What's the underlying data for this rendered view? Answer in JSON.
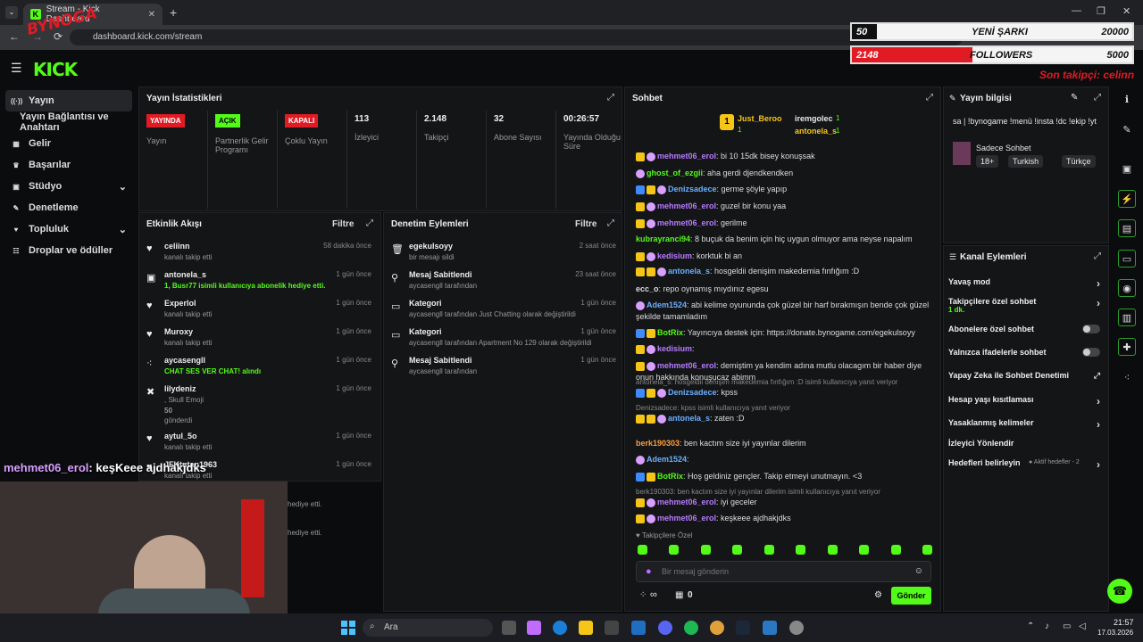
{
  "browser": {
    "tab_title": "Stream - Kick Dashboard",
    "url": "dashboard.kick.com/stream",
    "new_tab": "+"
  },
  "overlay": {
    "brand": "BYNOGA",
    "songs_count": "50",
    "songs_label": "YENİ ŞARKI",
    "songs_goal": "20000",
    "songs_progress": 0.0025,
    "followers_count": "2148",
    "followers_label": "FOLLOWERS",
    "followers_goal": "5000",
    "followers_progress": 0.43,
    "last_follower": "Son takipçi: celinn",
    "chat_overlay_user": "mehmet06_erol",
    "chat_overlay_msg": ": keşKeee ajdhakjdks"
  },
  "logo": "KICK",
  "sidebar": [
    {
      "label": "Yayın",
      "icon": "broadcast-icon",
      "active": true
    },
    {
      "label": "Yayın Bağlantısı ve Anahtarı",
      "icon": "",
      "active": false
    },
    {
      "label": "Gelir",
      "icon": "revenue-icon"
    },
    {
      "label": "Başarılar",
      "icon": "trophy-icon"
    },
    {
      "label": "Stüdyo",
      "icon": "studio-icon",
      "chevron": "⌄"
    },
    {
      "label": "Denetleme",
      "icon": "wrench-icon"
    },
    {
      "label": "Topluluk",
      "icon": "community-icon",
      "chevron": "⌄"
    },
    {
      "label": "Droplar ve ödüller",
      "icon": "gift-icon"
    }
  ],
  "stats": {
    "title": "Yayın İstatistikleri",
    "items": [
      {
        "badge": "YAYINDA",
        "label": "Yayın",
        "badge_color": "#e01b24",
        "badge_text": "#fff"
      },
      {
        "badge": "AÇIK",
        "label": "Partnerlik Gelir Programı",
        "badge_color": "#53fc18",
        "badge_text": "#000"
      },
      {
        "badge": "KAPALI",
        "label": "Çoklu Yayın",
        "badge_color": "#e01b24",
        "badge_text": "#fff"
      },
      {
        "value": "113",
        "label": "İzleyici"
      },
      {
        "value": "2.148",
        "label": "Takipçi"
      },
      {
        "value": "32",
        "label": "Abone Sayısı"
      },
      {
        "value": "00:26:57",
        "label": "Yayında Olduğu Süre"
      }
    ]
  },
  "activity": {
    "title": "Etkinlik Akışı",
    "filter": "Filtre",
    "items": [
      {
        "name": "celiinn",
        "sub": "kanalı takip etti",
        "time": "58 dakika önce",
        "icon": "heart-icon"
      },
      {
        "name": "antonela_s",
        "sub": "1, Busr77 isimli kullanıcıya abonelik hediye etti.",
        "time": "1 gün önce",
        "icon": "gift-icon"
      },
      {
        "name": "Experlol",
        "sub": "kanalı takip etti",
        "time": "1 gün önce",
        "icon": "heart-icon"
      },
      {
        "name": "Muroxy",
        "sub": "kanalı takip etti",
        "time": "1 gün önce",
        "icon": "heart-icon"
      },
      {
        "name": "aycasengll",
        "sub": "CHAT SES VER CHAT! alındı",
        "time": "1 gün önce",
        "icon": "reward-icon"
      },
      {
        "name": "lilydeniz",
        "sub": ", Skull Emoji",
        "sub2": "50",
        "sub3": "gönderdi",
        "time": "1 gün önce",
        "icon": "kicks-icon"
      },
      {
        "name": "aytul_5o",
        "sub": "kanalı takip etti",
        "time": "1 gün önce",
        "icon": "heart-icon"
      },
      {
        "name": "JFKtutan1963",
        "sub": "kanalı takip etti",
        "time": "1 gün önce",
        "icon": "heart-icon"
      }
    ],
    "extra": [
      "hediye etti.",
      "hediye etti."
    ]
  },
  "mod": {
    "title": "Denetim Eylemleri",
    "filter": "Filtre",
    "items": [
      {
        "name": "egekulsoyy",
        "sub": "bir mesajı sildi",
        "time": "2 saat önce",
        "icon": "trash-icon"
      },
      {
        "name": "Mesaj Sabitlendi",
        "sub": "aycasengll tarafından",
        "time": "23 saat önce",
        "icon": "pin-icon"
      },
      {
        "name": "Kategori",
        "sub": "aycasengll tarafından Just Chatting olarak değiştirildi",
        "time": "1 gün önce",
        "icon": "category-icon"
      },
      {
        "name": "Kategori",
        "sub": "aycasengll tarafından Apartment No 129 olarak değiştirildi",
        "time": "1 gün önce",
        "icon": "category-icon"
      },
      {
        "name": "Mesaj Sabitlendi",
        "sub": "aycasengll tarafından",
        "time": "1 gün önce",
        "icon": "pin-icon"
      }
    ]
  },
  "chat": {
    "title": "Sohbet",
    "top": [
      {
        "rank": "1",
        "name": "Just_Beroo",
        "count": "1"
      },
      {
        "name": "iremgolec",
        "count": "1"
      },
      {
        "name": "antonela_s",
        "count": "1"
      }
    ],
    "messages": [
      {
        "user": "mehmet06_erol",
        "color": "#b77bff",
        "badges": [
          "crown",
          "flame"
        ],
        "text": ": bi 10 15dk bisey konuşsak"
      },
      {
        "user": "ghost_of_ezgii",
        "color": "#53fc18",
        "badges": [
          "flame"
        ],
        "text": ": aha gerdi djendkendken"
      },
      {
        "user": "Denizsadece",
        "color": "#6ab0ff",
        "badges": [
          "blue",
          "crown",
          "flame"
        ],
        "text": ": germe şöyle yapıp"
      },
      {
        "user": "mehmet06_erol",
        "color": "#b77bff",
        "badges": [
          "crown",
          "flame"
        ],
        "text": ": guzel bir konu yaa"
      },
      {
        "user": "mehmet06_erol",
        "color": "#b77bff",
        "badges": [
          "crown",
          "flame"
        ],
        "text": ": gerilme"
      },
      {
        "user": "kubrayranci94",
        "color": "#53fc18",
        "badges": [],
        "text": ": 8 buçuk da benim için hiç uygun olmuyor ama neyse napalım"
      },
      {
        "user": "kedisium",
        "color": "#b77bff",
        "badges": [
          "crown",
          "flame"
        ],
        "text": ": korktuk bi an"
      },
      {
        "user": "antonela_s",
        "color": "#6ab0ff",
        "badges": [
          "crown",
          "crown",
          "flame"
        ],
        "text": ": hosgeldii denişim makedemia fınfığım :D"
      },
      {
        "user": "ecc_o",
        "color": "#ddd",
        "badges": [],
        "text": ": repo oynamış mıydınız egesu"
      },
      {
        "user": "Adem1524",
        "color": "#6ab0ff",
        "badges": [
          "flame"
        ],
        "text": ": abi kelime oyununda çok güzel bir harf bırakmışın bende çok güzel şekilde tamamladım"
      },
      {
        "user": "BotRix",
        "color": "#53fc18",
        "badges": [
          "blue",
          "crown"
        ],
        "text": ": Yayıncıya destek için: https://donate.bynogame.com/egekulsoyy"
      },
      {
        "user": "kedisium",
        "color": "#b77bff",
        "badges": [
          "crown",
          "flame"
        ],
        "text": ":"
      },
      {
        "user": "mehmet06_erol",
        "color": "#b77bff",
        "badges": [
          "crown",
          "flame"
        ],
        "text": ": demiştim ya kendim adına mutlu olacagım bir haber diye onun hakkında konuşucaz abimm"
      },
      {
        "reply": "antonela_s: hosgeldii denişim makedemia fınfığım :D isimli kullanıcıya yanıt veriyor",
        "user": "Denizsadece",
        "color": "#6ab0ff",
        "badges": [
          "blue",
          "crown",
          "flame"
        ],
        "text": ": kpss"
      },
      {
        "reply": "Denizsadece: kpss isimli kullanıcıya yanıt veriyor",
        "user": "antonela_s",
        "color": "#6ab0ff",
        "badges": [
          "crown",
          "crown",
          "flame"
        ],
        "text": ": zaten :D"
      },
      {
        "user": "berk190303",
        "color": "#ff9d3d",
        "badges": [],
        "text": ": ben kactım size iyi yayınlar dilerim"
      },
      {
        "user": "Adem1524",
        "color": "#6ab0ff",
        "badges": [
          "flame"
        ],
        "text": ":"
      },
      {
        "user": "BotRix",
        "color": "#53fc18",
        "badges": [
          "blue",
          "crown"
        ],
        "text": ": Hoş geldiniz gençler. Takip etmeyi unutmayın. <3"
      },
      {
        "reply": "berk190303: ben kactım size iyi yayınlar dilerim isimli kullanıcıya yanıt veriyor",
        "user": "mehmet06_erol",
        "color": "#b77bff",
        "badges": [
          "crown",
          "flame"
        ],
        "text": ": iyi geceler"
      },
      {
        "user": "mehmet06_erol",
        "color": "#b77bff",
        "badges": [
          "crown",
          "flame"
        ],
        "text": ": keşkeee ajdhakjdks"
      }
    ],
    "followers_only": "Takipçilere Özel",
    "placeholder": "Bir mesaj gönderin",
    "points": "∞",
    "kicks": "0",
    "send": "Gönder"
  },
  "streaminfo": {
    "title": "Yayın bilgisi",
    "stream_title": "sa | !bynogame !menü !insta !dc !ekip !yt",
    "category": "Sadece Sohbet",
    "tags": [
      "18+",
      "Turkish",
      "Türkçe"
    ]
  },
  "channel": {
    "title": "Kanal Eylemleri",
    "rows": [
      {
        "label": "Yavaş mod",
        "control": "chevron"
      },
      {
        "label": "Takipçilere özel sohbet",
        "sub": "1 dk.",
        "control": "chevron"
      },
      {
        "label": "Abonelere özel sohbet",
        "control": "toggle"
      },
      {
        "label": "Yalnızca ifadelerle sohbet",
        "control": "toggle"
      },
      {
        "label": "Yapay Zeka ile Sohbet Denetimi",
        "control": "external"
      },
      {
        "label": "Hesap yaşı kısıtlaması",
        "control": "chevron"
      },
      {
        "label": "Yasaklanmış kelimeler",
        "control": "chevron"
      },
      {
        "label": "İzleyici Yönlendir",
        "control": "none"
      },
      {
        "label": "Hedefleri belirleyin",
        "sub": "● Aktif hedefler - 2",
        "control": "chevron"
      }
    ]
  },
  "taskbar": {
    "search": "Ara",
    "time": "21:57",
    "date": "17.03.2026"
  }
}
